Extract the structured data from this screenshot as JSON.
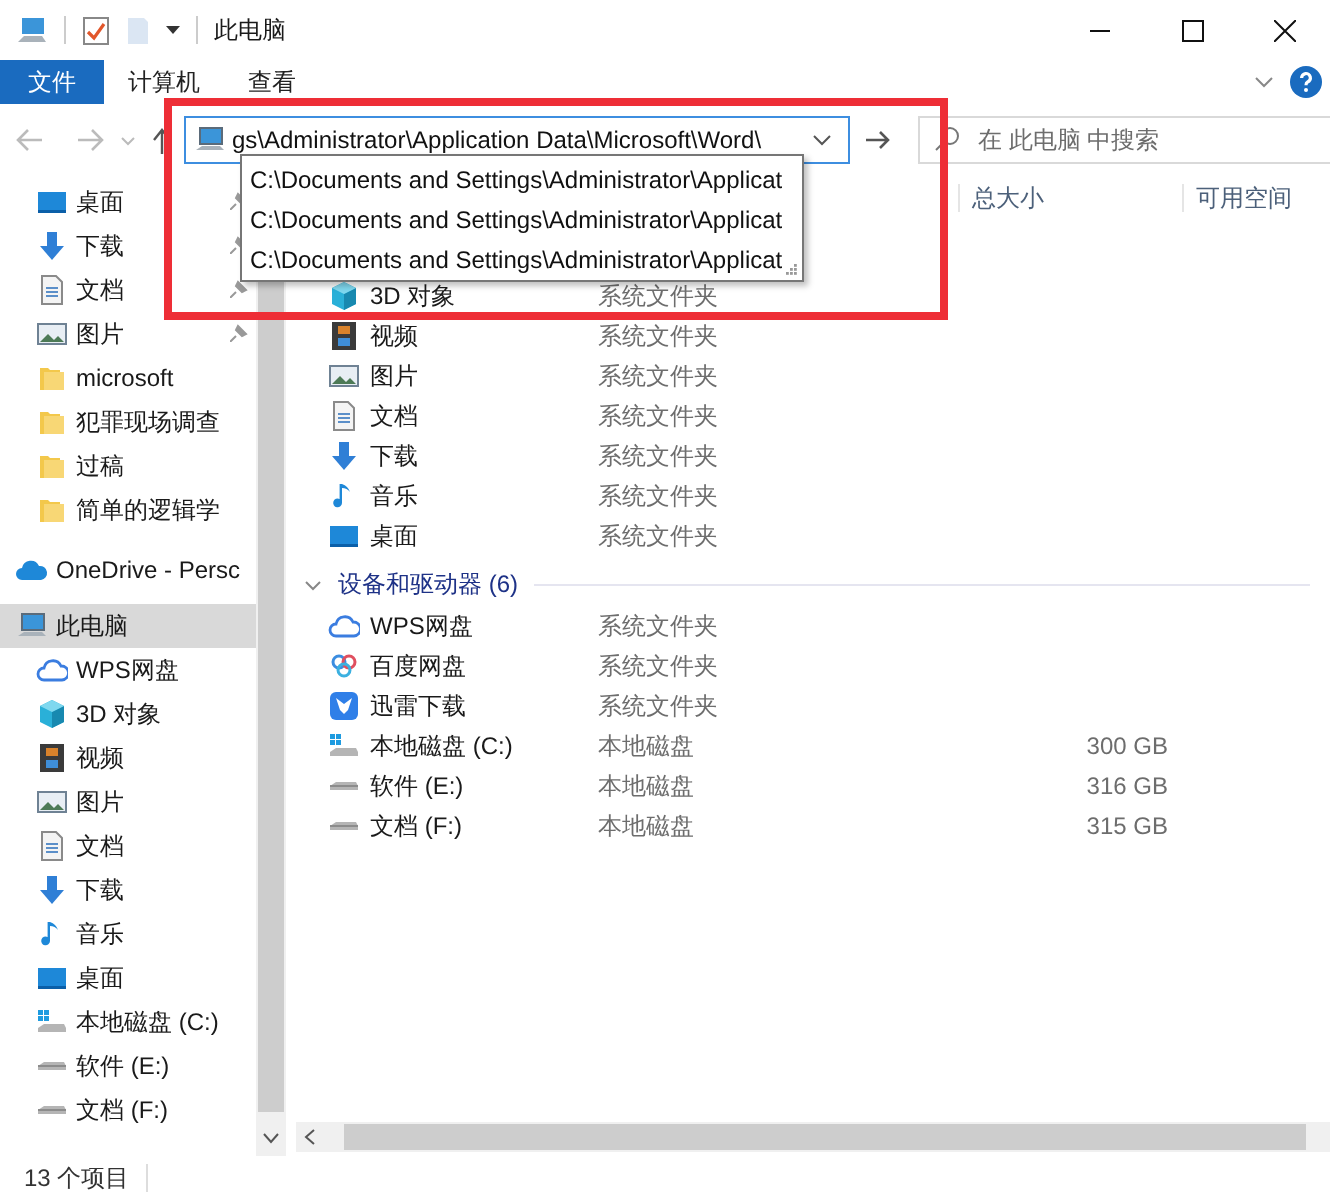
{
  "window": {
    "title": "此电脑"
  },
  "ribbon_tabs": [
    {
      "label": "文件",
      "selected": true
    },
    {
      "label": "计算机",
      "selected": false
    },
    {
      "label": "查看",
      "selected": false
    }
  ],
  "address": {
    "value": "gs\\Administrator\\Application Data\\Microsoft\\Word\\",
    "suggestions": [
      "C:\\Documents and Settings\\Administrator\\Applicat",
      "C:\\Documents and Settings\\Administrator\\Applicat",
      "C:\\Documents and Settings\\Administrator\\Applicat"
    ]
  },
  "search": {
    "placeholder": "在 此电脑 中搜索"
  },
  "nav": [
    {
      "label": "桌面",
      "kind": "desktop",
      "pinned": true,
      "selected": false
    },
    {
      "label": "下载",
      "kind": "download",
      "pinned": true,
      "selected": false
    },
    {
      "label": "文档",
      "kind": "document",
      "pinned": true,
      "selected": false
    },
    {
      "label": "图片",
      "kind": "picture",
      "pinned": true,
      "selected": false
    },
    {
      "label": "microsoft",
      "kind": "folder",
      "pinned": false,
      "selected": false
    },
    {
      "label": "犯罪现场调查",
      "kind": "folder",
      "pinned": false,
      "selected": false
    },
    {
      "label": "过稿",
      "kind": "folder",
      "pinned": false,
      "selected": false
    },
    {
      "label": "简单的逻辑学",
      "kind": "folder",
      "pinned": false,
      "selected": false
    },
    {
      "label": "OneDrive - Persc",
      "kind": "onedrive",
      "pinned": false,
      "selected": false
    },
    {
      "label": "此电脑",
      "kind": "pc",
      "pinned": false,
      "selected": true
    },
    {
      "label": "WPS网盘",
      "kind": "cloud",
      "pinned": false,
      "selected": false
    },
    {
      "label": "3D 对象",
      "kind": "cube",
      "pinned": false,
      "selected": false
    },
    {
      "label": "视频",
      "kind": "video",
      "pinned": false,
      "selected": false
    },
    {
      "label": "图片",
      "kind": "picture",
      "pinned": false,
      "selected": false
    },
    {
      "label": "文档",
      "kind": "document",
      "pinned": false,
      "selected": false
    },
    {
      "label": "下载",
      "kind": "download",
      "pinned": false,
      "selected": false
    },
    {
      "label": "音乐",
      "kind": "music",
      "pinned": false,
      "selected": false
    },
    {
      "label": "桌面",
      "kind": "desktop",
      "pinned": false,
      "selected": false
    },
    {
      "label": "本地磁盘 (C:)",
      "kind": "drive-c",
      "pinned": false,
      "selected": false
    },
    {
      "label": "软件 (E:)",
      "kind": "drive",
      "pinned": false,
      "selected": false
    },
    {
      "label": "文档 (F:)",
      "kind": "drive",
      "pinned": false,
      "selected": false
    }
  ],
  "columns": [
    "总大小",
    "可用空间"
  ],
  "folders": [
    {
      "name": "3D 对象",
      "kind": "cube",
      "type": "系统文件夹"
    },
    {
      "name": "视频",
      "kind": "video",
      "type": "系统文件夹"
    },
    {
      "name": "图片",
      "kind": "picture",
      "type": "系统文件夹"
    },
    {
      "name": "文档",
      "kind": "document",
      "type": "系统文件夹"
    },
    {
      "name": "下载",
      "kind": "download",
      "type": "系统文件夹"
    },
    {
      "name": "音乐",
      "kind": "music",
      "type": "系统文件夹"
    },
    {
      "name": "桌面",
      "kind": "desktop",
      "type": "系统文件夹"
    }
  ],
  "devices_group": {
    "title": "设备和驱动器 (6)",
    "expanded": true
  },
  "devices": [
    {
      "name": "WPS网盘",
      "kind": "cloud",
      "type": "系统文件夹"
    },
    {
      "name": "百度网盘",
      "kind": "baidu",
      "type": "系统文件夹"
    },
    {
      "name": "迅雷下载",
      "kind": "xunlei",
      "type": "系统文件夹"
    },
    {
      "name": "本地磁盘 (C:)",
      "kind": "drive-c",
      "type": "本地磁盘",
      "total_size": "300 GB"
    },
    {
      "name": "软件 (E:)",
      "kind": "drive",
      "type": "本地磁盘",
      "total_size": "316 GB"
    },
    {
      "name": "文档 (F:)",
      "kind": "drive",
      "type": "本地磁盘",
      "total_size": "315 GB"
    }
  ],
  "status_bar": {
    "count": "13 个项目"
  }
}
